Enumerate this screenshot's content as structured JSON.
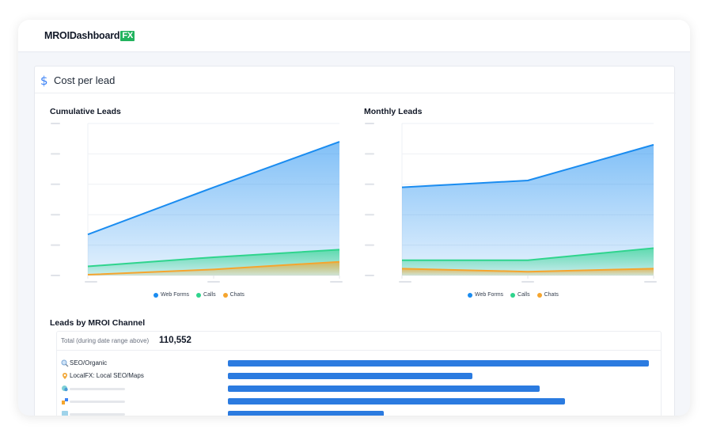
{
  "app": {
    "logo_text": "MROIDashboard",
    "logo_badge": "FX"
  },
  "panel": {
    "title": "Cost per lead",
    "icon": "dollar-icon"
  },
  "legend": {
    "web_forms": "Web Forms",
    "calls": "Calls",
    "chats": "Chats"
  },
  "colors": {
    "web_forms": "#1a8cf0",
    "calls": "#2fd48d",
    "chats": "#f5a52e",
    "bar": "#2b7be0",
    "accent": "#22b35e"
  },
  "channels": {
    "title": "Leads by MROI Channel",
    "total_label": "Total (during date range above)",
    "total_value": "110,552",
    "items": [
      {
        "name": "SEO/Organic",
        "icon": "magnifier-icon",
        "fraction": 1.0
      },
      {
        "name": "LocalFX: Local SEO/Maps",
        "icon": "map-pin-icon",
        "fraction": 0.58
      },
      {
        "name": "",
        "icon": "chat-icon",
        "fraction": 0.74
      },
      {
        "name": "",
        "icon": "link-icon",
        "fraction": 0.8
      },
      {
        "name": "",
        "icon": "ad-icon",
        "fraction": 0.37
      }
    ]
  },
  "chart_data": [
    {
      "type": "area",
      "title": "Cumulative Leads",
      "xlabel": "",
      "ylabel": "",
      "tick_labels_visible": false,
      "x": [
        1,
        2,
        3
      ],
      "ylim": [
        0,
        100
      ],
      "series": [
        {
          "name": "Web Forms",
          "values": [
            27,
            58,
            88
          ]
        },
        {
          "name": "Calls",
          "values": [
            6,
            12,
            17
          ]
        },
        {
          "name": "Chats",
          "values": [
            0.5,
            4,
            9
          ]
        }
      ],
      "legend": "bottom",
      "grid": true
    },
    {
      "type": "area",
      "title": "Monthly Leads",
      "xlabel": "",
      "ylabel": "",
      "tick_labels_visible": false,
      "x": [
        1,
        2,
        3
      ],
      "ylim": [
        0,
        100
      ],
      "series": [
        {
          "name": "Web Forms",
          "values": [
            58,
            62.5,
            86
          ]
        },
        {
          "name": "Calls",
          "values": [
            10,
            10,
            18
          ]
        },
        {
          "name": "Chats",
          "values": [
            4.5,
            2.5,
            4.5
          ]
        }
      ],
      "legend": "bottom",
      "grid": true
    }
  ]
}
